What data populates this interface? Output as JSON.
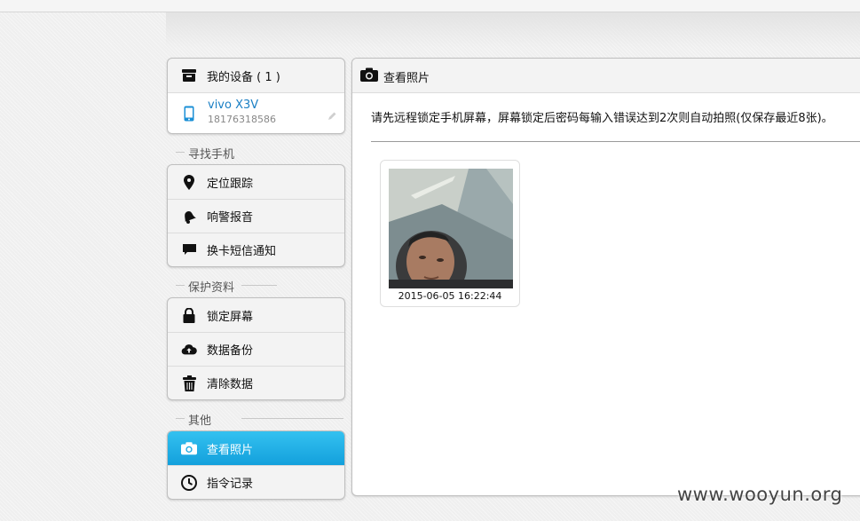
{
  "sidebar": {
    "my_devices": {
      "title": "我的设备 ( 1 )",
      "icon": "device-box-icon"
    },
    "device": {
      "name": "vivo X3V",
      "number": "18176318586",
      "icon": "phone-icon",
      "edit_icon": "pencil-icon"
    },
    "find_phone": {
      "label": "寻找手机",
      "items": [
        {
          "label": "定位跟踪",
          "icon": "location-pin-icon"
        },
        {
          "label": "响警报音",
          "icon": "bell-icon"
        },
        {
          "label": "换卡短信通知",
          "icon": "message-icon"
        }
      ]
    },
    "protect_data": {
      "label": "保护资料",
      "items": [
        {
          "label": "锁定屏幕",
          "icon": "lock-icon"
        },
        {
          "label": "数据备份",
          "icon": "cloud-upload-icon"
        },
        {
          "label": "清除数据",
          "icon": "trash-icon"
        }
      ]
    },
    "other": {
      "label": "其他",
      "items": [
        {
          "label": "查看照片",
          "icon": "camera-icon",
          "active": true
        },
        {
          "label": "指令记录",
          "icon": "clock-icon"
        }
      ]
    }
  },
  "panel": {
    "title": "查看照片",
    "icon": "camera-icon",
    "notice": "请先远程锁定手机屏幕，屏幕锁定后密码每输入错误达到2次则自动拍照(仅保存最近8张)。",
    "photos": [
      {
        "timestamp": "2015-06-05 16:22:44"
      }
    ]
  },
  "watermark": "www.wooyun.org",
  "colors": {
    "accent": "#1aa8e2",
    "device_name": "#1a7fc4"
  }
}
